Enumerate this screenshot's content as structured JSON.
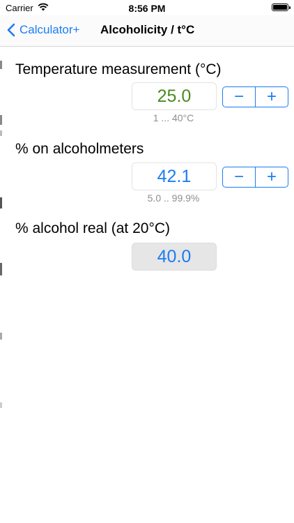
{
  "status_bar": {
    "carrier": "Carrier",
    "time": "8:56 PM",
    "wifi_icon": "wifi-icon",
    "battery_icon": "battery-icon"
  },
  "nav": {
    "back_label": "Calculator+",
    "back_icon": "chevron-left-icon",
    "title": "Alcoholicity / t°C"
  },
  "colors": {
    "accent": "#1a7cf5",
    "temperature_value": "#4a8a1f",
    "range_text": "#8e8e93",
    "readonly_bg": "#e6e6e6"
  },
  "fields": {
    "temperature": {
      "label": "Temperature measurement (°C)",
      "value": "25.0",
      "range": "1 ... 40°C",
      "minus": "−",
      "plus": "+"
    },
    "alcoholmeter": {
      "label": "% on alcoholmeters",
      "value": "42.1",
      "range": "5.0 .. 99.9%",
      "minus": "−",
      "plus": "+"
    },
    "real": {
      "label": "% alcohol real (at 20°C)",
      "value": "40.0"
    }
  }
}
